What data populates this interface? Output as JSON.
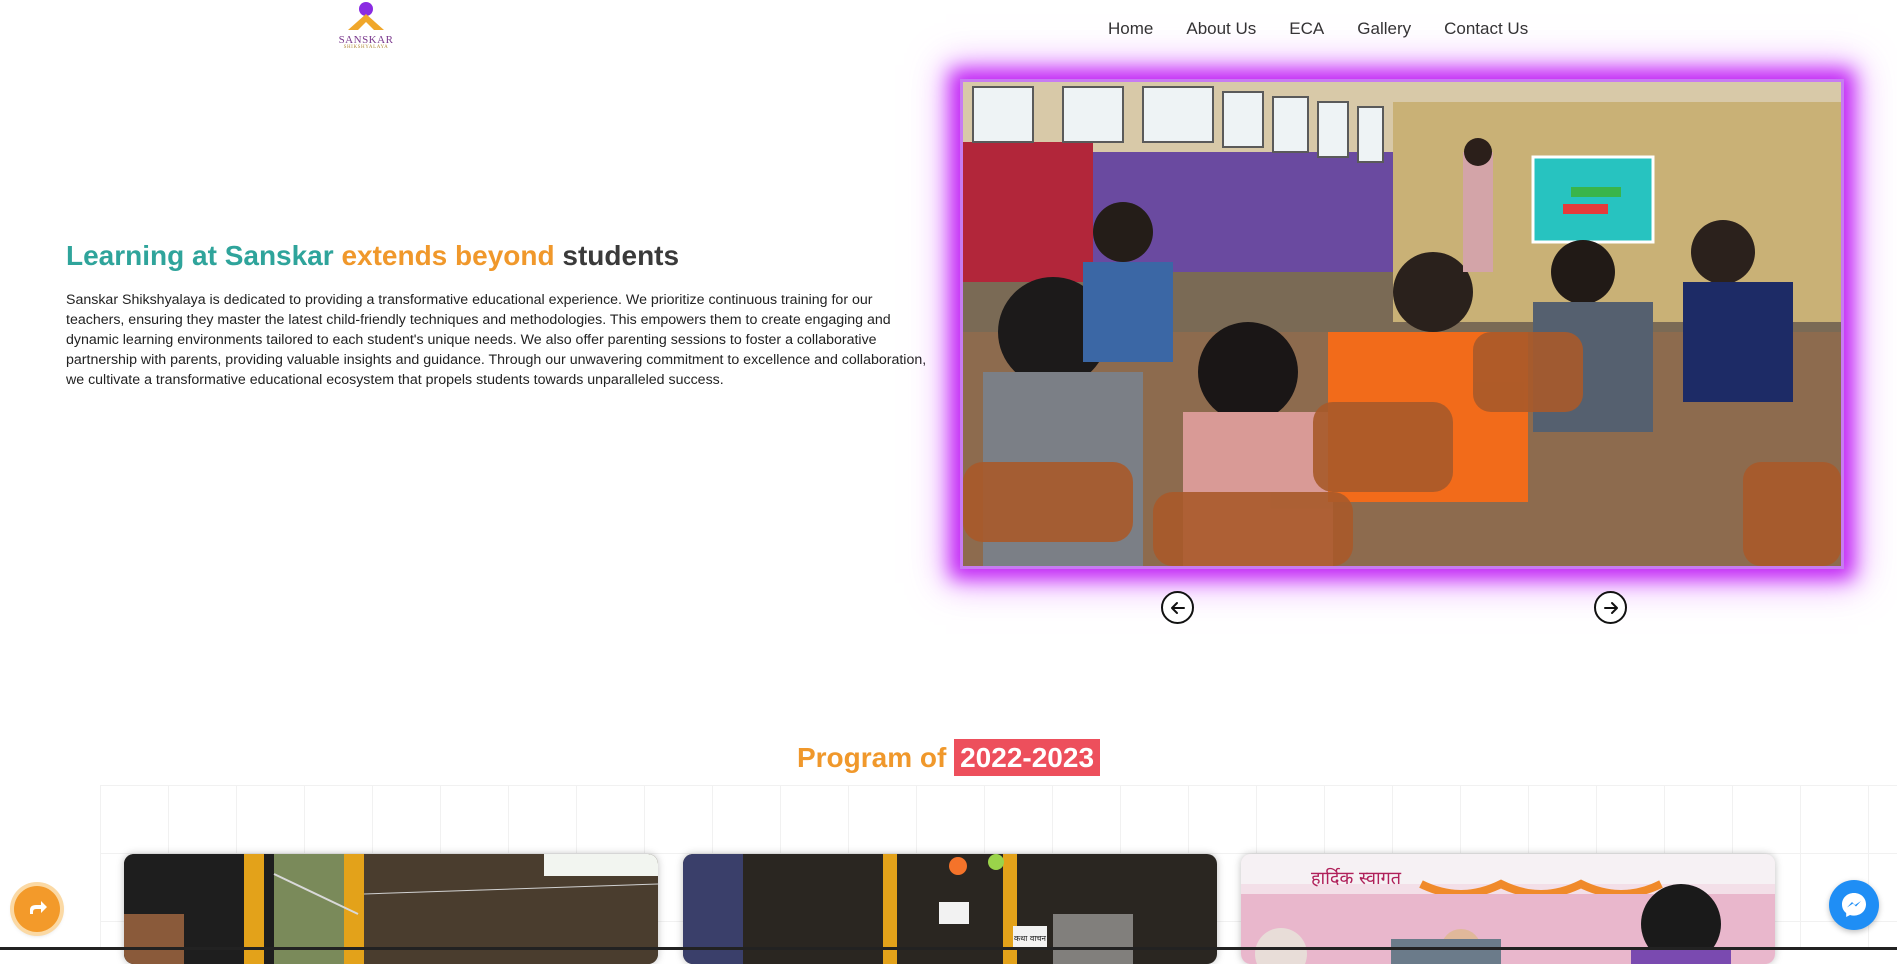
{
  "header": {
    "logo": {
      "brand": "SANSKAR",
      "sub": "SHIKSHYALAYA"
    },
    "nav": [
      "Home",
      "About Us",
      "ECA",
      "Gallery",
      "Contact Us"
    ]
  },
  "hero": {
    "title_part1": "Learning at Sanskar",
    "title_part2": "extends beyond",
    "title_part3": "students",
    "paragraph": "Sanskar Shikshyalaya is dedicated to providing a transformative educational experience. We prioritize continuous training for our teachers, ensuring they master the latest child-friendly techniques and methodologies. This empowers them to create engaging and dynamic learning environments tailored to each student's unique needs. We also offer parenting sessions to foster a collaborative partnership with parents, providing valuable insights and guidance. Through our unwavering commitment to excellence and collaboration, we cultivate a transformative educational ecosystem that propels students towards unparalleled success."
  },
  "slider": {
    "photo_icon": "classroom-photo",
    "prev_icon": "arrow-left-icon",
    "next_icon": "arrow-right-icon"
  },
  "program": {
    "title_part1": "Program of",
    "title_year": "2022-2023",
    "cards": [
      {
        "icon": "stairs-photo"
      },
      {
        "icon": "event-photo",
        "sign_text": "कथा वाचन"
      },
      {
        "icon": "ceremony-photo",
        "banner_text": "हार्दिक स्वागत"
      }
    ]
  },
  "floating": {
    "share_icon": "share-icon",
    "messenger_icon": "messenger-icon"
  },
  "colors": {
    "teal": "#2fa49b",
    "orange": "#f0982b",
    "purple_glow": "#c227f5",
    "red": "#ed4f5c",
    "messenger": "#1f8ef5"
  }
}
